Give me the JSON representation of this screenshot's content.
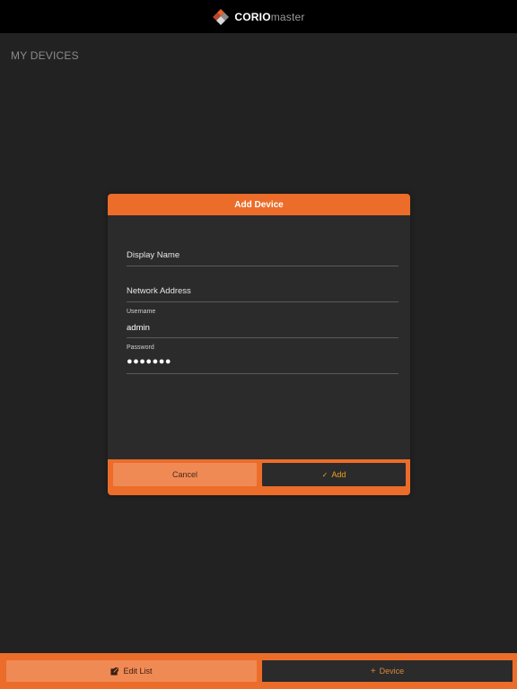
{
  "app": {
    "logo_bold": "CORIO",
    "logo_light": "master",
    "logo_icon": "corio-diamond-logo-icon"
  },
  "page": {
    "title": "MY DEVICES"
  },
  "modal": {
    "title": "Add Device",
    "fields": {
      "display_name": {
        "label": "",
        "value": "",
        "placeholder": "Display Name"
      },
      "network_address": {
        "label": "",
        "value": "",
        "placeholder": "Network Address"
      },
      "username": {
        "label": "Username",
        "value": "admin"
      },
      "password": {
        "label": "Password",
        "value": "●●●●●●●"
      }
    },
    "buttons": {
      "cancel": "Cancel",
      "add_check": "✓",
      "add": "Add"
    }
  },
  "bottom_bar": {
    "edit_icon": "edit-pencil-icon",
    "edit_label": "Edit List",
    "device_plus": "+",
    "device_label": "Device"
  },
  "colors": {
    "accent": "#ec6c2a",
    "background": "#222222",
    "header": "#000000",
    "modal": "#2b2b2b",
    "add_text": "#f0a020"
  }
}
